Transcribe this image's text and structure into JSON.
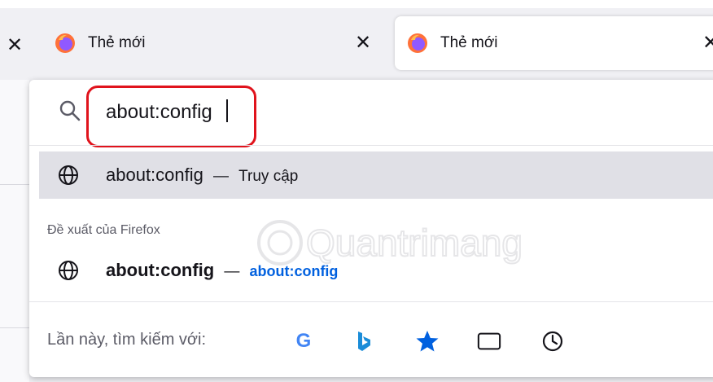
{
  "tabs": [
    {
      "title": "Thẻ mới",
      "close": "✕"
    },
    {
      "title": "Thẻ mới",
      "close": "✕"
    }
  ],
  "left_tab_close": "✕",
  "urlbar": {
    "value": "about:config",
    "search_icon": "search-icon"
  },
  "suggestions": {
    "top": {
      "text": "about:config",
      "separator": "—",
      "action": "Truy cập",
      "icon": "globe-icon"
    },
    "section_label": "Đề xuất của Firefox",
    "firefox": {
      "text": "about:config",
      "separator": "—",
      "url": "about:config",
      "icon": "globe-icon"
    }
  },
  "search_engines": {
    "label": "Lần này, tìm kiếm với:",
    "items": [
      "google-icon",
      "bing-icon",
      "bookmarks-star-icon",
      "tabs-icon",
      "history-icon"
    ]
  },
  "watermark": "Quantrimang",
  "colors": {
    "highlight_border": "#e0131c",
    "selected_row": "#e0e0e6",
    "link_blue": "#0060df",
    "bookmark_blue": "#0060df"
  }
}
